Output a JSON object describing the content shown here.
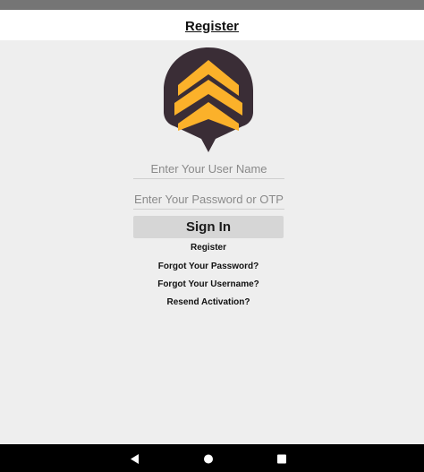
{
  "header": {
    "register_link": "Register"
  },
  "logo": {
    "icon": "chevron-pin-logo",
    "colors": {
      "body": "#3a2d36",
      "stripes": "#fbb12a"
    }
  },
  "form": {
    "username_placeholder": "Enter Your User Name",
    "username_value": "",
    "password_placeholder": "Enter Your Password or OTP",
    "password_value": "",
    "signin_label": "Sign In"
  },
  "links": {
    "register": "Register",
    "forgot_password": "Forgot Your Password?",
    "forgot_username": "Forgot Your Username?",
    "resend_activation": "Resend Activation?"
  },
  "navbar": {
    "back_icon": "triangle-back-icon",
    "home_icon": "circle-home-icon",
    "recents_icon": "square-recents-icon"
  },
  "colors": {
    "background": "#eeeeee",
    "header": "#ffffff",
    "status_bar": "#757575",
    "nav_bar": "#000000",
    "button": "#d6d6d6"
  }
}
